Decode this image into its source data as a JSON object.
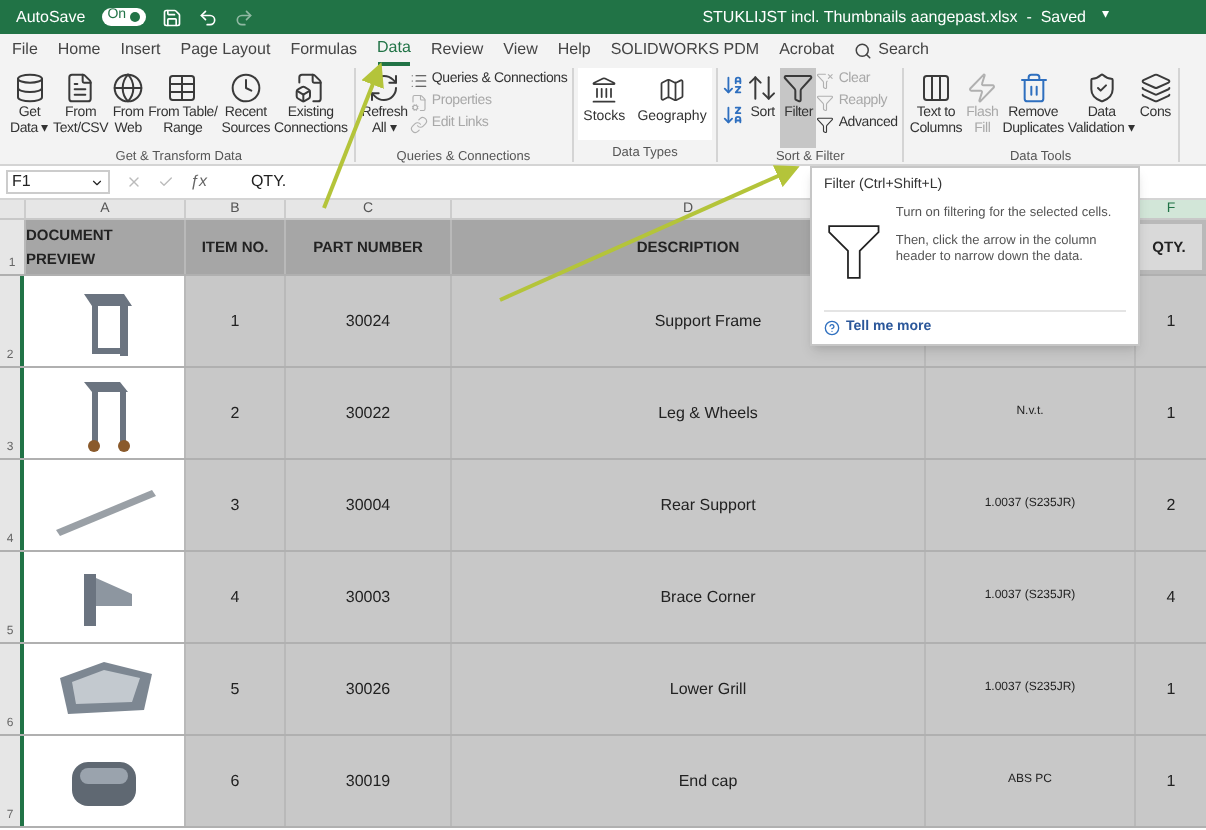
{
  "title_bar": {
    "autosave_label": "AutoSave",
    "autosave": {
      "on": true,
      "label": "On"
    },
    "title": "STUKLIJST incl. Thumbnails aangepast.xlsx  -  Saved",
    "caret": "▾"
  },
  "tabs": [
    {
      "label": "File",
      "selected": false
    },
    {
      "label": "Home",
      "selected": false
    },
    {
      "label": "Insert",
      "selected": false
    },
    {
      "label": "Page Layout",
      "selected": false
    },
    {
      "label": "Formulas",
      "selected": false
    },
    {
      "label": "Data",
      "selected": true
    },
    {
      "label": "Review",
      "selected": false
    },
    {
      "label": "View",
      "selected": false
    },
    {
      "label": "Help",
      "selected": false
    },
    {
      "label": "SOLIDWORKS PDM",
      "selected": false
    },
    {
      "label": "Acrobat",
      "selected": false
    }
  ],
  "search": {
    "label": "Search"
  },
  "ribbon": [
    {
      "label": "Get & Transform Data",
      "items": [
        {
          "kind": "large",
          "label": "Get\nData ▾",
          "disabled": false,
          "selected": false
        },
        {
          "kind": "large",
          "label": "From\nText/CSV",
          "disabled": false,
          "selected": false
        },
        {
          "kind": "large",
          "label": "From\nWeb",
          "disabled": false,
          "selected": false
        },
        {
          "kind": "large",
          "label": "From Table/\nRange",
          "disabled": false,
          "selected": false
        },
        {
          "kind": "large",
          "label": "Recent\nSources",
          "disabled": false,
          "selected": false
        },
        {
          "kind": "large",
          "label": "Existing\nConnections",
          "disabled": false,
          "selected": false
        }
      ]
    },
    {
      "label": "Queries & Connections",
      "items": [
        {
          "kind": "large",
          "label": "Refresh\nAll ▾",
          "disabled": false,
          "selected": false
        },
        {
          "kind": "small",
          "label": "Queries & Connections",
          "disabled": false,
          "selected": false
        },
        {
          "kind": "small",
          "label": "Properties",
          "disabled": true,
          "selected": false
        },
        {
          "kind": "small",
          "label": "Edit Links",
          "disabled": true,
          "selected": false
        }
      ]
    },
    {
      "label": "Data Types",
      "items": [
        {
          "kind": "gallery",
          "label": "Stocks",
          "disabled": false,
          "selected": false
        },
        {
          "kind": "gallery",
          "label": "Geography",
          "disabled": false,
          "selected": false
        }
      ]
    },
    {
      "label": "Sort & Filter",
      "items": [
        {
          "kind": "sortpair",
          "disabled": false,
          "selected": false
        },
        {
          "kind": "large",
          "label": "Sort",
          "disabled": false,
          "selected": false
        },
        {
          "kind": "large",
          "label": "Filter",
          "disabled": false,
          "selected": true
        },
        {
          "kind": "small",
          "label": "Clear",
          "disabled": true,
          "selected": false
        },
        {
          "kind": "small",
          "label": "Reapply",
          "disabled": true,
          "selected": false
        },
        {
          "kind": "small",
          "label": "Advanced",
          "disabled": false,
          "selected": false
        }
      ]
    },
    {
      "label": "Data Tools",
      "items": [
        {
          "kind": "large",
          "label": "Text to\nColumns",
          "disabled": false,
          "selected": false
        },
        {
          "kind": "large",
          "label": "Flash\nFill",
          "disabled": true,
          "selected": false
        },
        {
          "kind": "large",
          "label": "Remove\nDuplicates",
          "disabled": false,
          "selected": false
        },
        {
          "kind": "large",
          "label": "Data\nValidation ▾",
          "disabled": false,
          "selected": false
        },
        {
          "kind": "large",
          "label": "Cons",
          "disabled": false,
          "selected": false
        }
      ]
    }
  ],
  "formula_bar": {
    "name_box": "F1",
    "function_label": "ƒx",
    "formula": "QTY."
  },
  "column_letters": [
    "A",
    "B",
    "C",
    "D",
    "F"
  ],
  "headers": [
    "DOCUMENT PREVIEW",
    "ITEM NO.",
    "PART NUMBER",
    "DESCRIPTION",
    "QTY."
  ],
  "rows": [
    {
      "row": "2",
      "item": "1",
      "part": "30024",
      "description": "Support Frame",
      "qty": "1"
    },
    {
      "row": "3",
      "item": "2",
      "part": "30022",
      "description": "Leg & Wheels",
      "material": "N.v.t.",
      "qty": "1"
    },
    {
      "row": "4",
      "item": "3",
      "part": "30004",
      "description": "Rear Support",
      "material": "1.0037 (S235JR)",
      "qty": "2"
    },
    {
      "row": "5",
      "item": "4",
      "part": "30003",
      "description": "Brace Corner",
      "material": "1.0037 (S235JR)",
      "qty": "4"
    },
    {
      "row": "6",
      "item": "5",
      "part": "30026",
      "description": "Lower Grill",
      "material": "1.0037 (S235JR)",
      "qty": "1"
    },
    {
      "row": "7",
      "item": "6",
      "part": "30019",
      "description": "End cap",
      "material": "ABS PC",
      "qty": "1"
    }
  ],
  "header_row_number": "1",
  "tooltip": {
    "title": "Filter (Ctrl+Shift+L)",
    "lines": [
      "Turn on filtering for the selected cells.",
      "Then, click the arrow in the column header to narrow down the data."
    ],
    "link": "Tell me more"
  }
}
